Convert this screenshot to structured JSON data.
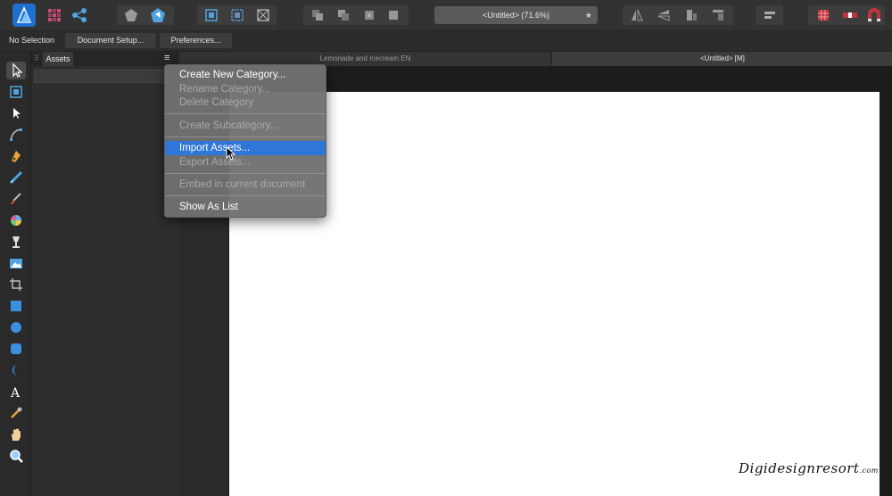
{
  "toolbar": {
    "document_title": "<Untitled> (71.6%)"
  },
  "context_bar": {
    "selection_label": "No Selection",
    "document_setup_label": "Document Setup...",
    "preferences_label": "Preferences..."
  },
  "assets_panel": {
    "tab_label": "Assets",
    "menu_glyph": "≡"
  },
  "document_tabs": [
    {
      "label": "Lemonade and Icecream EN"
    },
    {
      "label": "<Untitled> [M]"
    }
  ],
  "menu": {
    "items": [
      {
        "label": "Create New Category...",
        "enabled": true
      },
      {
        "label": "Rename Category...",
        "enabled": false
      },
      {
        "label": "Delete Category",
        "enabled": false
      },
      {
        "label": "Create Subcategory...",
        "enabled": false
      },
      {
        "label": "Import Assets...",
        "enabled": true,
        "highlighted": true
      },
      {
        "label": "Export Assets...",
        "enabled": false
      },
      {
        "label": "Embed in current document",
        "enabled": false
      },
      {
        "label": "Show As List",
        "enabled": true
      }
    ]
  },
  "watermark": {
    "text": "Digidesignresort",
    "suffix": ".com"
  },
  "colors": {
    "accent": "#2f76d6",
    "app_logo": "#1f6fd0"
  }
}
